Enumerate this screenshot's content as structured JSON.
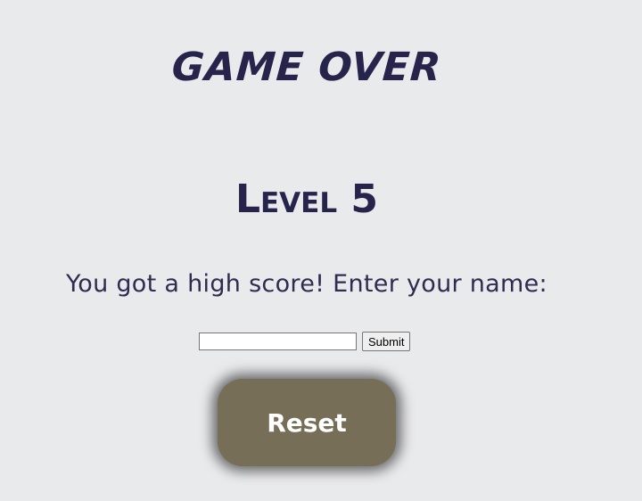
{
  "game": {
    "title": "GAME OVER",
    "level_label": "Level 5",
    "high_score_prompt": "You got a high score! Enter your name:",
    "name_input": {
      "value": "",
      "placeholder": ""
    },
    "submit_label": "Submit",
    "reset_label": "Reset"
  },
  "colors": {
    "background": "#e9eaec",
    "heading_text": "#26244a",
    "reset_button": "#766e56",
    "reset_text": "#ffffff"
  }
}
